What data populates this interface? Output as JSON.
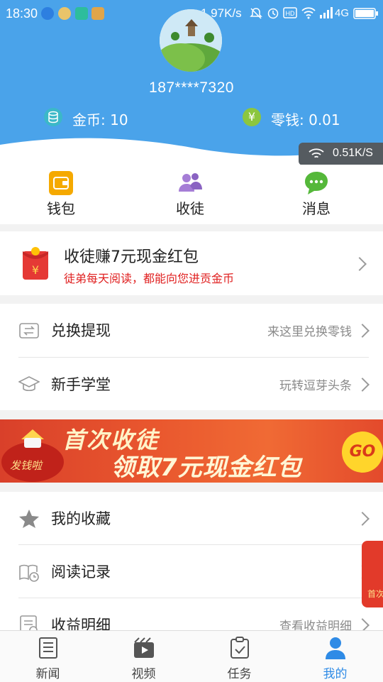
{
  "status_bar": {
    "time": "18:30",
    "net_speed": "1.97K/s",
    "network_type": "4G",
    "icons": [
      "qq-icon",
      "wechat-icon",
      "scan-icon",
      "app-icon",
      "mute-icon",
      "alarm-icon",
      "hd-icon",
      "wifi-icon",
      "signal-icon",
      "battery-icon"
    ]
  },
  "profile": {
    "phone": "187****7320",
    "coins_label": "金币: 10",
    "change_label": "零钱: 0.01"
  },
  "net_badge": "0.51K/S",
  "quick_actions": [
    {
      "label": "钱包",
      "icon": "wallet-icon",
      "color": "#f5a900"
    },
    {
      "label": "收徒",
      "icon": "users-icon",
      "color": "#9a6fce"
    },
    {
      "label": "消息",
      "icon": "message-icon",
      "color": "#55b83a"
    }
  ],
  "promo": {
    "title": "收徒赚7元现金红包",
    "subtitle": "徒弟每天阅读，都能向您进贡金币"
  },
  "menu_group1": [
    {
      "label": "兑换提现",
      "right": "来这里兑换零钱",
      "icon": "exchange-icon"
    },
    {
      "label": "新手学堂",
      "right": "玩转逗芽头条",
      "icon": "graduation-cap-icon"
    }
  ],
  "banner": {
    "line1": "首次收徒",
    "line2": "领取7元现金红包",
    "go": "GO",
    "badge": "发钱啦"
  },
  "menu_group2": [
    {
      "label": "我的收藏",
      "right": "",
      "icon": "star-icon"
    },
    {
      "label": "阅读记录",
      "right": "",
      "icon": "book-clock-icon"
    },
    {
      "label": "收益明细",
      "right": "查看收益明细",
      "icon": "ledger-icon"
    }
  ],
  "float_badge": "首次",
  "tabs": [
    {
      "label": "新闻",
      "icon": "news-icon",
      "active": false
    },
    {
      "label": "视频",
      "icon": "video-icon",
      "active": false
    },
    {
      "label": "任务",
      "icon": "task-icon",
      "active": false
    },
    {
      "label": "我的",
      "icon": "profile-icon",
      "active": true
    }
  ],
  "colors": {
    "header_blue": "#4aa3ea",
    "accent_red": "#e02020",
    "active_tab": "#2f8be6"
  }
}
